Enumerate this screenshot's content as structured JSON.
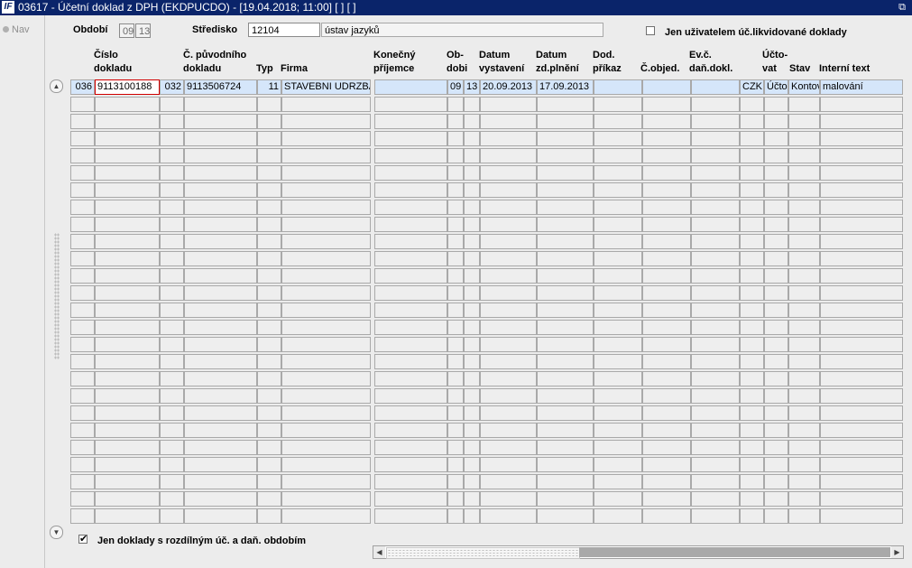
{
  "window": {
    "title": "03617 - Účetní doklad z DPH (EKDPUCDO) - [19.04.2018; 11:00]  [ ]  [ ]",
    "app_icon_text": "IF"
  },
  "nav": {
    "label": "Nav"
  },
  "filters": {
    "obdobi_label": "Období",
    "obdobi_month": "09",
    "obdobi_year": "13",
    "stredisko_label": "Středisko",
    "stredisko_code": "12104",
    "stredisko_name": "ústav jazyků",
    "only_user_label": "Jen uživatelem úč.likvidované doklady",
    "only_user_checked": false
  },
  "columns": [
    "Číslo\ndokladu",
    "Č. původního\ndokladu",
    "Typ",
    "Firma",
    "Konečný\npříjemce",
    "Ob-\ndobi",
    "Datum\nvystavení",
    "Datum\nzd.plnění",
    "Dod.\npříkaz",
    "Č.objed.",
    "Ev.č.\ndaň.dokl.",
    "Účto-\nvat",
    "Stav",
    "Interní text"
  ],
  "rows": [
    {
      "prefix": "036",
      "cislo_dokladu": "9113100188",
      "puvodni_prefix": "032",
      "puvodni_dokladu": "9113506724",
      "typ": "11",
      "firma": "STAVEBNI UDRZBA",
      "konecny_prijemce": "",
      "obdobi_month": "09",
      "obdobi_year": "13",
      "datum_vystaveni": "20.09.2013",
      "datum_zd_plneni": "17.09.2013",
      "dod_prikaz": "",
      "c_objed": "",
      "ev_c_dan_dokl": "",
      "mena": "CZK",
      "uctovat": "Účto",
      "stav": "Kontov",
      "interni_text": "malování"
    }
  ],
  "empty_row_count": 25,
  "footer": {
    "rozdilne_obdobi_label": "Jen doklady s rozdílným úč. a daň. obdobím",
    "rozdilne_obdobi_checked": true
  },
  "colors": {
    "title_bar": "#0a246a",
    "selected_row": "#d5e6fa",
    "focus_border": "#d00000"
  }
}
